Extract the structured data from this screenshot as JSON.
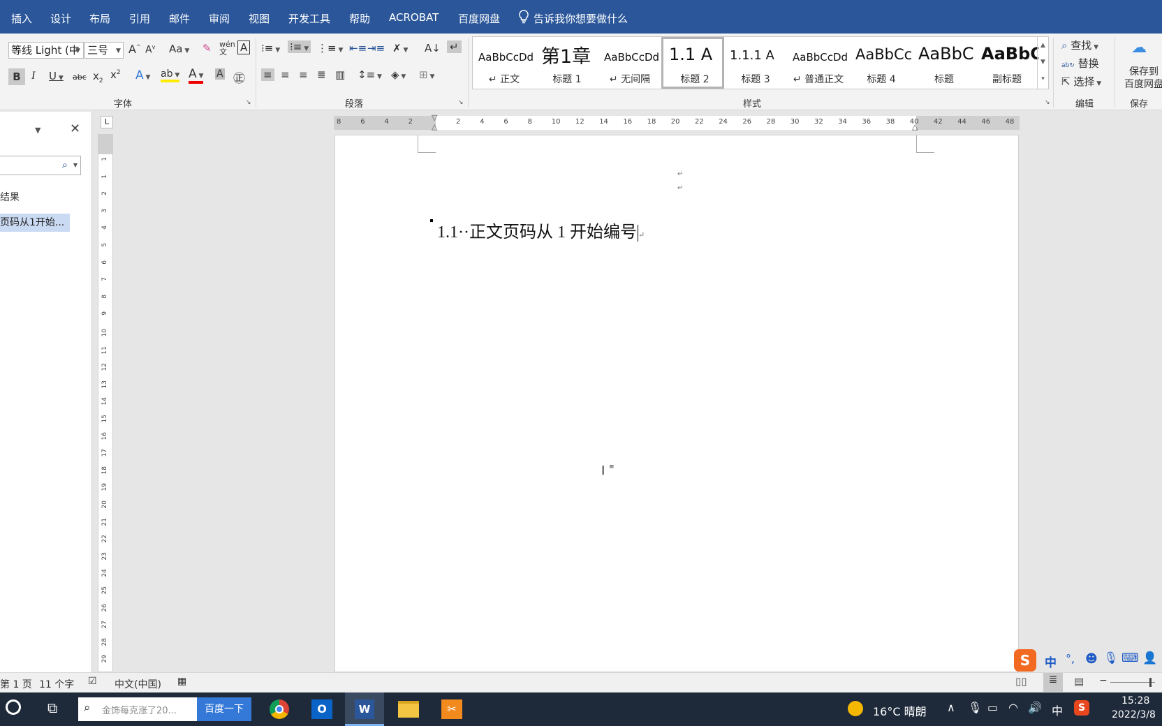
{
  "menubar": {
    "tabs": [
      "插入",
      "设计",
      "布局",
      "引用",
      "邮件",
      "审阅",
      "视图",
      "开发工具",
      "帮助",
      "ACROBAT",
      "百度网盘"
    ],
    "tellme": "告诉我你想要做什么"
  },
  "ribbon": {
    "font_name": "等线 Light (中",
    "font_size": "三号",
    "change_case": "Aa",
    "groups": {
      "font": "字体",
      "paragraph": "段落",
      "styles": "样式",
      "editing": "编辑",
      "save": "保存"
    },
    "styles": [
      {
        "preview": "AaBbCcDd",
        "name": "↵ 正文"
      },
      {
        "preview": "第1章",
        "name": "标题 1"
      },
      {
        "preview": "AaBbCcDd",
        "name": "↵ 无间隔"
      },
      {
        "preview": "1.1  A",
        "name": "标题 2"
      },
      {
        "preview": "1.1.1  A",
        "name": "标题 3"
      },
      {
        "preview": "AaBbCcDd",
        "name": "↵ 普通正文"
      },
      {
        "preview": "AaBbCc",
        "name": "标题 4"
      },
      {
        "preview": "AaBbC",
        "name": "标题"
      },
      {
        "preview": "AaBbC",
        "name": "副标题"
      }
    ],
    "editing": {
      "find": "查找",
      "replace": "替换",
      "select": "选择"
    },
    "save_baidu": [
      "保存到",
      "百度网盘"
    ]
  },
  "nav": {
    "results_label": "结果",
    "heading_item": "页码从1开始..."
  },
  "ruler": {
    "h_labels": [
      "8",
      "6",
      "4",
      "2",
      "",
      "2",
      "4",
      "6",
      "8",
      "10",
      "12",
      "14",
      "16",
      "18",
      "20",
      "22",
      "24",
      "26",
      "28",
      "30",
      "32",
      "34",
      "36",
      "38",
      "40",
      "42",
      "44",
      "46",
      "48"
    ],
    "v_labels": [
      "1",
      "1",
      "2",
      "3",
      "4",
      "5",
      "6",
      "7",
      "8",
      "9",
      "10",
      "11",
      "12",
      "13",
      "14",
      "15",
      "16",
      "17",
      "18",
      "19",
      "20",
      "21",
      "22",
      "23",
      "24",
      "25",
      "26",
      "27",
      "28",
      "29"
    ]
  },
  "document": {
    "heading": "1.1··正文页码从 1 开始编号"
  },
  "statusbar": {
    "page": "第 1 页",
    "words": "11 个字",
    "language": "中文(中国)"
  },
  "ime": {
    "mode": "中"
  },
  "taskbar": {
    "search_placeholder": "金饰每克涨了20...",
    "search_button": "百度一下",
    "weather": "16°C  晴朗",
    "ime": "中",
    "time": "15:28",
    "date": "2022/3/8"
  }
}
